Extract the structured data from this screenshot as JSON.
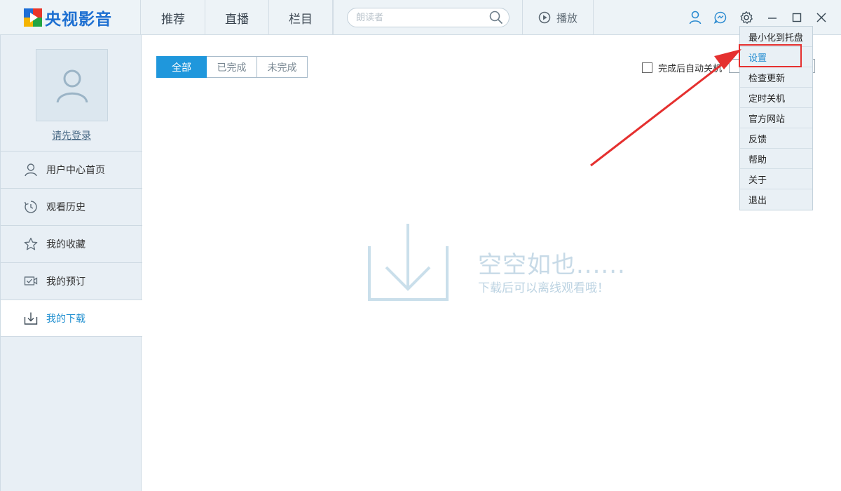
{
  "app": {
    "title": "央视影音"
  },
  "nav": {
    "tabs": [
      "推荐",
      "直播",
      "栏目"
    ]
  },
  "search": {
    "placeholder": "朗读者"
  },
  "play": {
    "label": "播放"
  },
  "user": {
    "login_link": "请先登录"
  },
  "sidebar": {
    "items": [
      {
        "label": "用户中心首页",
        "icon": "user-icon"
      },
      {
        "label": "观看历史",
        "icon": "history-icon"
      },
      {
        "label": "我的收藏",
        "icon": "star-icon"
      },
      {
        "label": "我的预订",
        "icon": "reserve-icon"
      },
      {
        "label": "我的下载",
        "icon": "download-icon",
        "active": true
      }
    ]
  },
  "filter": {
    "tabs": [
      "全部",
      "已完成",
      "未完成"
    ],
    "selected": "全部"
  },
  "options": {
    "auto_shutdown_label": "完成后自动关机",
    "auto_shutdown_checked": false
  },
  "empty": {
    "title": "空空如也......",
    "subtitle": "下载后可以离线观看哦！"
  },
  "settings_menu": {
    "items": [
      "最小化到托盘",
      "设置",
      "检查更新",
      "定时关机",
      "官方网站",
      "反馈",
      "帮助",
      "关于",
      "退出"
    ],
    "highlighted": "设置"
  },
  "colors": {
    "accent": "#1f97dc",
    "annotation": "#e5302f",
    "logo": "#1d6fd1"
  }
}
